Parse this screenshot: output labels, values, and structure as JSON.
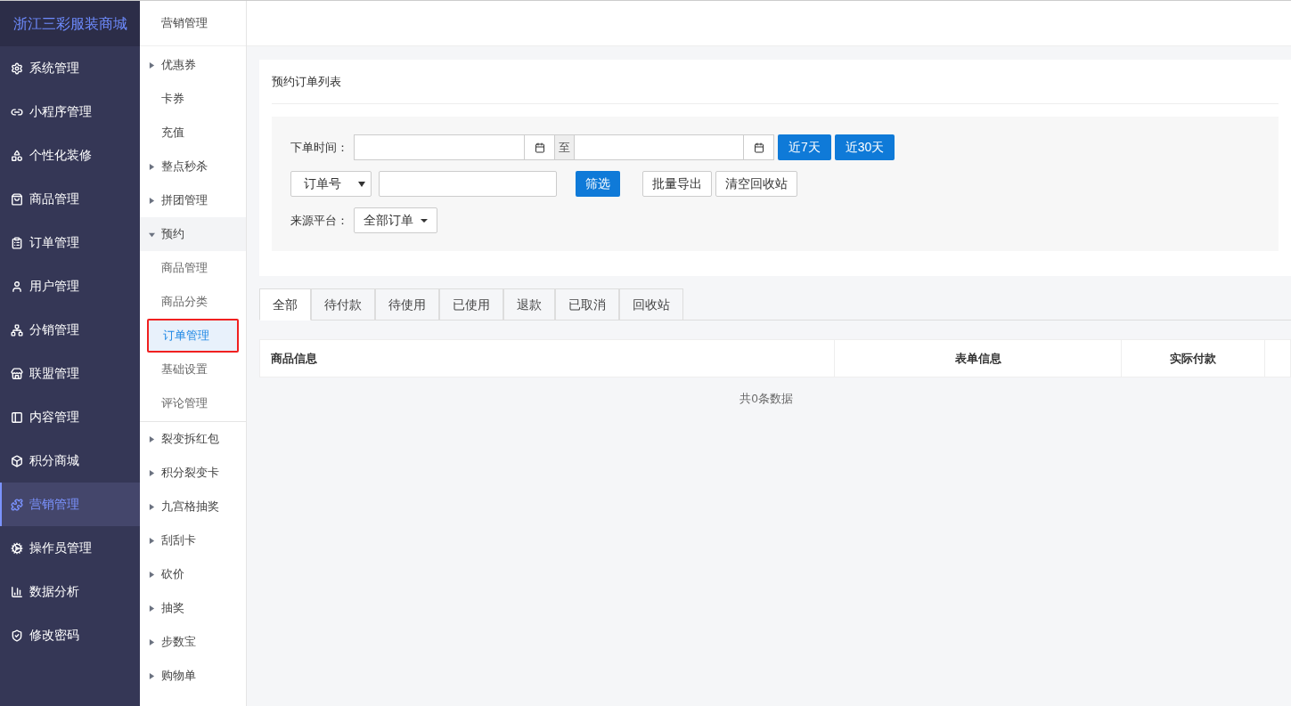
{
  "brand": "浙江三彩服装商城",
  "sidebar": {
    "items": [
      {
        "label": "系统管理",
        "selected": false
      },
      {
        "label": "小程序管理",
        "selected": false
      },
      {
        "label": "个性化装修",
        "selected": false
      },
      {
        "label": "商品管理",
        "selected": false
      },
      {
        "label": "订单管理",
        "selected": false
      },
      {
        "label": "用户管理",
        "selected": false
      },
      {
        "label": "分销管理",
        "selected": false
      },
      {
        "label": "联盟管理",
        "selected": false
      },
      {
        "label": "内容管理",
        "selected": false
      },
      {
        "label": "积分商城",
        "selected": false
      },
      {
        "label": "营销管理",
        "selected": true
      },
      {
        "label": "操作员管理",
        "selected": false
      },
      {
        "label": "数据分析",
        "selected": false
      },
      {
        "label": "修改密码",
        "selected": false
      }
    ]
  },
  "submenu": {
    "title": "营销管理",
    "items": [
      {
        "label": "优惠券",
        "kind": "group",
        "expanded": false
      },
      {
        "label": "卡券",
        "kind": "link",
        "selected": false
      },
      {
        "label": "充值",
        "kind": "link",
        "selected": false
      },
      {
        "label": "整点秒杀",
        "kind": "group",
        "expanded": false
      },
      {
        "label": "拼团管理",
        "kind": "group",
        "expanded": false
      },
      {
        "label": "预约",
        "kind": "group",
        "expanded": true,
        "children": [
          {
            "label": "商品管理",
            "selected": false
          },
          {
            "label": "商品分类",
            "selected": false
          },
          {
            "label": "订单管理",
            "selected": true
          },
          {
            "label": "基础设置",
            "selected": false
          },
          {
            "label": "评论管理",
            "selected": false
          }
        ]
      },
      {
        "label": "裂变拆红包",
        "kind": "group",
        "expanded": false
      },
      {
        "label": "积分裂变卡",
        "kind": "group",
        "expanded": false
      },
      {
        "label": "九宫格抽奖",
        "kind": "group",
        "expanded": false
      },
      {
        "label": "刮刮卡",
        "kind": "group",
        "expanded": false
      },
      {
        "label": "砍价",
        "kind": "group",
        "expanded": false
      },
      {
        "label": "抽奖",
        "kind": "group",
        "expanded": false
      },
      {
        "label": "步数宝",
        "kind": "group",
        "expanded": false
      },
      {
        "label": "购物单",
        "kind": "group",
        "expanded": false
      }
    ]
  },
  "panel_title": "预约订单列表",
  "filters": {
    "order_time_label": "下单时间：",
    "range_separator": "至",
    "quick_buttons": [
      "近7天",
      "近30天"
    ],
    "search_type": "订单号",
    "filter_button": "筛选",
    "actions": [
      "批量导出",
      "清空回收站"
    ],
    "source_label": "来源平台：",
    "source_value": "全部订单"
  },
  "tabs": [
    {
      "label": "全部",
      "selected": true
    },
    {
      "label": "待付款",
      "selected": false
    },
    {
      "label": "待使用",
      "selected": false
    },
    {
      "label": "已使用",
      "selected": false
    },
    {
      "label": "退款",
      "selected": false
    },
    {
      "label": "已取消",
      "selected": false
    },
    {
      "label": "回收站",
      "selected": false
    }
  ],
  "table": {
    "columns": [
      "商品信息",
      "表单信息",
      "实际付款"
    ],
    "empty_text": "共0条数据"
  }
}
